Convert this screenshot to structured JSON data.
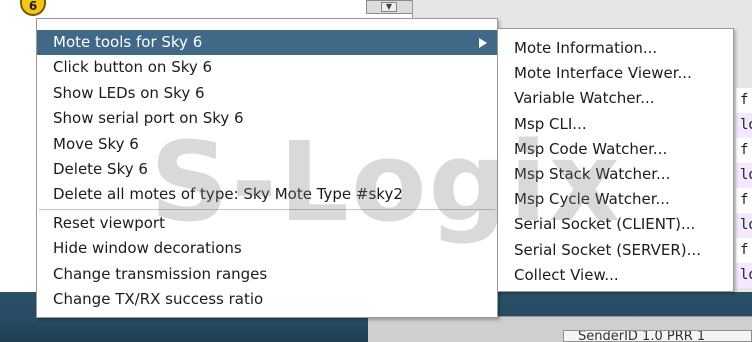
{
  "background": {
    "node_label": "6",
    "log_lines": [
      "f",
      "lo",
      "f",
      "lo",
      "f",
      "lo",
      "f",
      "lo",
      "f"
    ],
    "status_text": "SenderID 1.0 PRR 1"
  },
  "main_menu": {
    "items": [
      {
        "label": "Mote tools for Sky 6",
        "has_submenu": true,
        "highlighted": true
      },
      {
        "label": "Click button on Sky 6"
      },
      {
        "label": "Show LEDs on Sky 6"
      },
      {
        "label": "Show serial port on Sky 6"
      },
      {
        "label": "Move Sky 6"
      },
      {
        "label": "Delete Sky 6"
      },
      {
        "label": "Delete all motes of type: Sky Mote Type #sky2"
      },
      {
        "label": "Reset viewport"
      },
      {
        "label": "Hide window decorations"
      },
      {
        "label": "Change transmission ranges"
      },
      {
        "label": "Change TX/RX success ratio"
      }
    ]
  },
  "sub_menu": {
    "items": [
      {
        "label": "Mote Information..."
      },
      {
        "label": "Mote Interface Viewer..."
      },
      {
        "label": "Variable Watcher..."
      },
      {
        "label": "Msp CLI..."
      },
      {
        "label": "Msp Code Watcher..."
      },
      {
        "label": "Msp Stack Watcher..."
      },
      {
        "label": "Msp Cycle Watcher..."
      },
      {
        "label": "Serial Socket (CLIENT)..."
      },
      {
        "label": "Serial Socket (SERVER)..."
      },
      {
        "label": "Collect View..."
      }
    ]
  },
  "watermark": "S-Logix",
  "colors": {
    "highlight": "#3f6987",
    "desktop": "#2a5068"
  }
}
